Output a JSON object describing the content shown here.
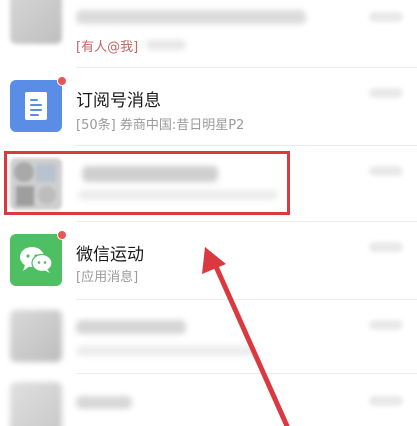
{
  "chat_list": {
    "rows": [
      {
        "title": "",
        "preview_tag": "[有人@我]",
        "preview": ""
      },
      {
        "title": "订阅号消息",
        "preview_tag": "[50条]",
        "preview": " 券商中国:昔日明星P2"
      },
      {
        "title": "",
        "preview_tag": "",
        "preview": ""
      },
      {
        "title": "微信运动",
        "preview_tag": "[应用消息]",
        "preview": ""
      },
      {
        "title": "",
        "preview_tag": "",
        "preview": ""
      },
      {
        "title": "",
        "preview_tag": "",
        "preview": ""
      }
    ]
  },
  "icons": {
    "subscription": "document-icon",
    "sports": "wechat-chat-bubbles-icon"
  },
  "colors": {
    "highlight": "#d9393f",
    "arrow": "#d9393f",
    "badge": "#e8574f",
    "subscription_avatar": "#5a8ee6",
    "sports_avatar": "#4fbf63"
  }
}
